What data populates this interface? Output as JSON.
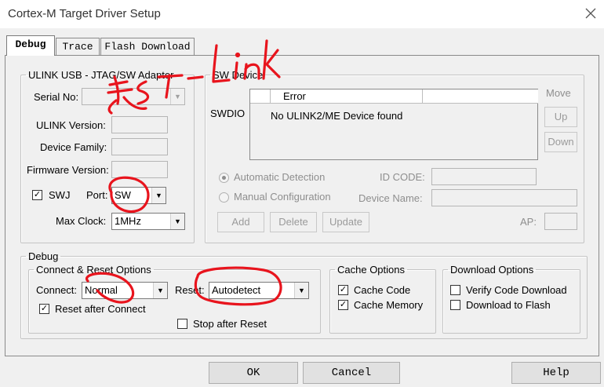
{
  "window": {
    "title": "Cortex-M Target Driver Setup"
  },
  "tabs": [
    {
      "label": "Debug",
      "active": true
    },
    {
      "label": "Trace",
      "active": false
    },
    {
      "label": "Flash Download",
      "active": false
    }
  ],
  "ulink": {
    "legend": "ULINK USB - JTAG/SW Adapter",
    "serial_label": "Serial No:",
    "version_label": "ULINK Version:",
    "family_label": "Device Family:",
    "firmware_label": "Firmware Version:",
    "swj_label": "SWJ",
    "swj_checked": true,
    "port_label": "Port:",
    "port_value": "SW",
    "clock_label": "Max Clock:",
    "clock_value": "1MHz"
  },
  "sw_device": {
    "legend": "SW Device",
    "swdio_label": "SWDIO",
    "col_error": "Error",
    "row_text": "No ULINK2/ME Device found",
    "move_label": "Move",
    "up": "Up",
    "down": "Down",
    "auto_detect": "Automatic Detection",
    "manual_config": "Manual Configuration",
    "id_code_label": "ID CODE:",
    "device_name_label": "Device Name:",
    "add": "Add",
    "delete": "Delete",
    "update": "Update",
    "ap_label": "AP:"
  },
  "debug": {
    "legend": "Debug",
    "connect_reset": {
      "legend": "Connect & Reset Options",
      "connect_label": "Connect:",
      "connect_value": "Normal",
      "reset_label": "Reset:",
      "reset_value": "Autodetect",
      "reset_after_connect": "Reset after Connect",
      "reset_after_connect_checked": true,
      "stop_after_reset": "Stop after Reset",
      "stop_after_reset_checked": false
    },
    "cache": {
      "legend": "Cache Options",
      "cache_code": "Cache Code",
      "cache_code_checked": true,
      "cache_memory": "Cache Memory",
      "cache_memory_checked": true
    },
    "download": {
      "legend": "Download Options",
      "verify": "Verify Code Download",
      "verify_checked": false,
      "download_flash": "Download to Flash",
      "download_flash_checked": false
    }
  },
  "footer": {
    "ok": "OK",
    "cancel": "Cancel",
    "help": "Help"
  },
  "annotation": {
    "text": "ST-Link",
    "color": "#e8141d"
  }
}
